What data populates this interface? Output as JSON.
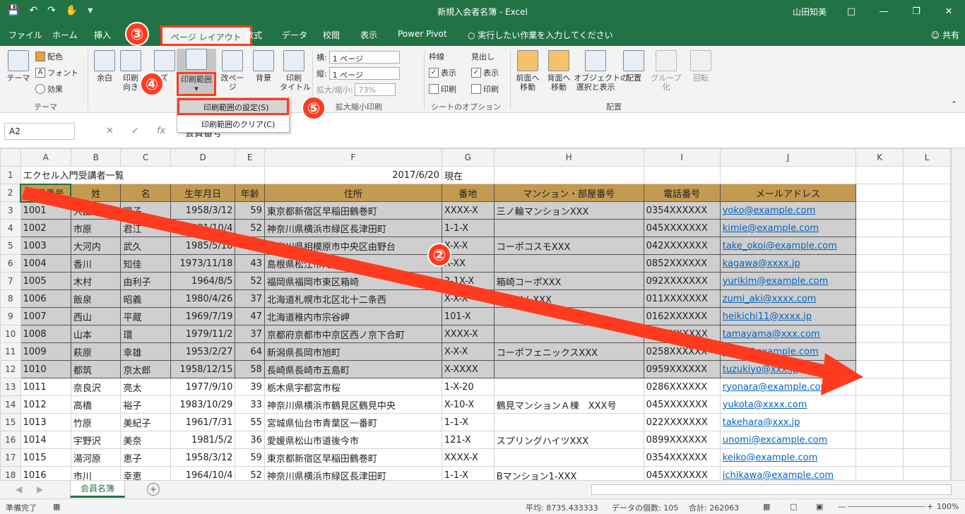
{
  "window": {
    "title": "新規入会者名簿 - Excel",
    "user": "山田知美"
  },
  "tabs": [
    "ファイル",
    "ホーム",
    "挿入",
    "ページ レイアウト",
    "数式",
    "データ",
    "校閲",
    "表示",
    "Power Pivot",
    "実行したい作業を入力してください"
  ],
  "share_label": "共有",
  "ribbon": {
    "theme": {
      "theme_label": "テーマ",
      "colors_label": "配色",
      "fonts_label": "フォント",
      "effects_label": "効果",
      "group_label": "テーマ"
    },
    "margins_label": "余白",
    "orientation_label": "印刷\n向き",
    "size_label": "ズ",
    "print_area_label": "印刷範囲",
    "breaks_label": "改ページ",
    "background_label": "背景",
    "print_titles_label": "印刷\nタイトル",
    "scale": {
      "width_label": "横:",
      "width_value": "1 ページ",
      "height_label": "縦:",
      "height_value": "1 ページ",
      "scale_label": "拡大/縮小:",
      "scale_value": "73%",
      "group_label": "拡大縮小印刷"
    },
    "sheet_options": {
      "gridlines_label": "枠線",
      "headings_label": "見出し",
      "view_label": "表示",
      "print_label": "印刷",
      "group_label": "シートのオプション"
    },
    "arrange": {
      "bring_forward": "前面へ\n移動",
      "send_backward": "背面へ\n移動",
      "selection_pane": "オブジェクトの\n選択と表示",
      "align": "配置",
      "group": "グループ化",
      "rotate": "回転",
      "group_label": "配置"
    }
  },
  "dropdown": {
    "set_print_area": "印刷範囲の設定(S)",
    "clear_print_area": "印刷範囲のクリア(C)"
  },
  "badges": [
    "③",
    "④",
    "⑤",
    "②"
  ],
  "name_box": "A2",
  "formula_value": "会員番号",
  "columns": [
    "A",
    "B",
    "C",
    "D",
    "E",
    "F",
    "G",
    "H",
    "I",
    "J",
    "K",
    "L"
  ],
  "sheet": {
    "row1_a": "エクセル入門受講者一覧",
    "row1_date": "2017/6/20",
    "row1_suffix": "現在",
    "headers": [
      "会員番号",
      "姓",
      "名",
      "生年月日",
      "年齢",
      "住所",
      "番地",
      "マンション・部屋番号",
      "電話番号",
      "メールアドレス"
    ],
    "rows": [
      [
        "1001",
        "大田原",
        "陽子",
        "1958/3/12",
        "59",
        "東京都新宿区早稲田鶴巻町",
        "XXXX-X",
        "三ノ輪マンションXXX",
        "0354XXXXXX",
        "yoko@example.com"
      ],
      [
        "1002",
        "市原",
        "君江",
        "1981/10/4",
        "52",
        "神奈川県横浜市緑区長津田町",
        "1-1-X",
        "",
        "045XXXXXXX",
        "kimie@example.com"
      ],
      [
        "1003",
        "大河内",
        "武久",
        "1985/5/18",
        "32",
        "神奈川県相模原市中央区由野台",
        "X-X-X",
        "コーポコスモXXX",
        "042XXXXXXX",
        "take_okoi@example.com"
      ],
      [
        "1004",
        "香川",
        "知佳",
        "1973/11/18",
        "43",
        "島根県松江市内中原町",
        "X-XX",
        "",
        "0852XXXXXX",
        "kagawa@xxxx.jp"
      ],
      [
        "1005",
        "木村",
        "由利子",
        "1964/8/5",
        "52",
        "福岡県福岡市東区箱崎",
        "2-1X-X",
        "箱崎コーポXXX",
        "092XXXXXXX",
        "yurikim@example.com"
      ],
      [
        "1006",
        "飯泉",
        "昭義",
        "1980/4/26",
        "37",
        "北海道札幌市北区北十二条西",
        "X-X-X",
        "北ハイムXXX",
        "011XXXXXXX",
        "zumi_aki@xxxx.com"
      ],
      [
        "1007",
        "西山",
        "平蔵",
        "1969/7/19",
        "47",
        "北海道稚内市宗谷岬",
        "101-X",
        "",
        "0162XXXXXX",
        "heikichi11@xxxx.jp"
      ],
      [
        "1008",
        "山本",
        "環",
        "1979/11/2",
        "37",
        "京都府京都市中京区西ノ京下合町",
        "XXXX-X",
        "",
        "075XXXXXXX",
        "tamayama@xxx.com"
      ],
      [
        "1009",
        "萩原",
        "幸雄",
        "1953/2/27",
        "64",
        "新潟県長岡市旭町",
        "X-X-X",
        "コーポフェニックスXXX",
        "0258XXXXXX",
        "yukio@example.com"
      ],
      [
        "1010",
        "都筑",
        "京太郎",
        "1958/12/15",
        "58",
        "長崎県長崎市五島町",
        "X-XXXX",
        "",
        "0959XXXXXX",
        "tuzukiyo@xxx.jp"
      ],
      [
        "1011",
        "奈良沢",
        "亮太",
        "1977/9/10",
        "39",
        "栃木県宇都宮市桜",
        "1-X-20",
        "",
        "0286XXXXXX",
        "ryonara@example.com"
      ],
      [
        "1012",
        "高橋",
        "裕子",
        "1983/10/29",
        "33",
        "神奈川県横浜市鶴見区鶴見中央",
        "X-10-X",
        "鶴見マンションＡ棟　XXX号",
        "045XXXXXXX",
        "yukota@xxxx.com"
      ],
      [
        "1013",
        "竹原",
        "美紀子",
        "1961/7/31",
        "55",
        "宮城県仙台市青葉区一番町",
        "1-1-X",
        "",
        "022XXXXXXX",
        "takehara@xxx.jp"
      ],
      [
        "1014",
        "宇野沢",
        "美奈",
        "1981/5/2",
        "36",
        "愛媛県松山市道後今市",
        "121-X",
        "スプリングハイツXXX",
        "0899XXXXXX",
        "unomi@excample.com"
      ],
      [
        "1015",
        "湯河原",
        "恵子",
        "1958/3/12",
        "59",
        "東京都新宿区早稲田鶴巻町",
        "XXXX-X",
        "",
        "0354XXXXXX",
        "keiko@example.com"
      ],
      [
        "1016",
        "市川",
        "幸恵",
        "1964/10/4",
        "52",
        "神奈川県横浜市緑区長津田町",
        "1-1-X",
        "Bマンション1-XXX",
        "045XXXXXXX",
        "ichikawa@example.com"
      ]
    ]
  },
  "sheet_tab": "会員名簿",
  "status": {
    "ready": "準備完了",
    "average": "平均: 8735.433333",
    "count": "データの個数: 105",
    "sum": "合計: 262063",
    "zoom": "100%"
  },
  "colors": {
    "excel_green": "#217346",
    "header_fill": "#c49a51",
    "highlight": "#ff3b1f"
  }
}
